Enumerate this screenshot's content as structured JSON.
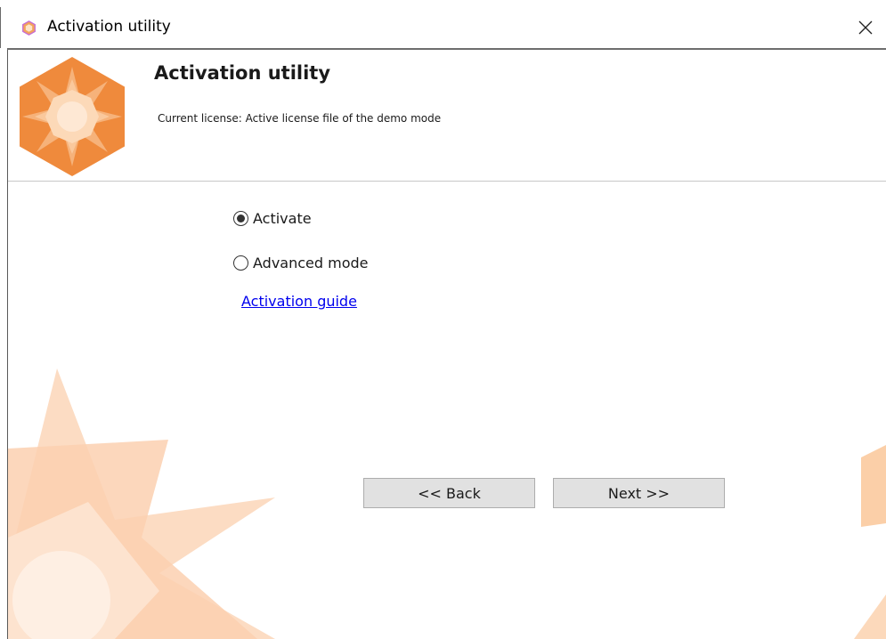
{
  "window": {
    "title": "Activation utility",
    "close_glyph": "✕"
  },
  "header": {
    "title": "Activation utility",
    "subtitle": "Current license: Active license file of the demo mode"
  },
  "options": [
    {
      "label": "Activate",
      "selected": true
    },
    {
      "label": "Advanced mode",
      "selected": false
    }
  ],
  "link": {
    "label": "Activation guide"
  },
  "buttons": {
    "back_label": "<< Back",
    "next_label": "Next >>"
  },
  "colors": {
    "accent_orange": "#ef8a3c",
    "background_star": "#fbd3b4",
    "link_blue": "#0000ee"
  },
  "icons": {
    "window_icon": "app-hexagon-icon",
    "logo": "star-hexagon-logo",
    "close": "close-icon"
  }
}
